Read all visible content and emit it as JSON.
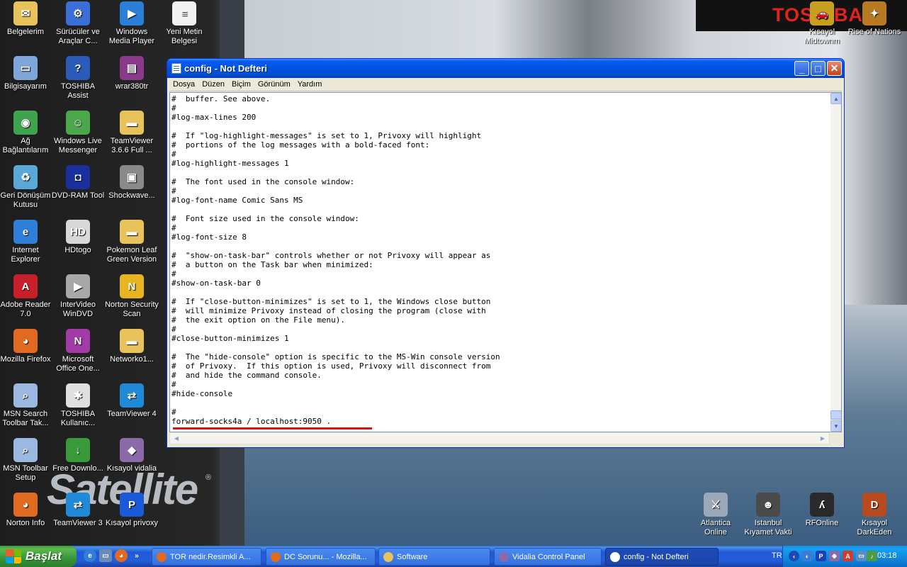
{
  "window": {
    "title": "config - Not Defteri",
    "menu": [
      "Dosya",
      "Düzen",
      "Biçim",
      "Görünüm",
      "Yardım"
    ]
  },
  "editor_lines": [
    "#  buffer. See above.",
    "#",
    "#log-max-lines 200",
    "",
    "#  If \"log-highlight-messages\" is set to 1, Privoxy will highlight",
    "#  portions of the log messages with a bold-faced font:",
    "#",
    "#log-highlight-messages 1",
    "",
    "#  The font used in the console window:",
    "#",
    "#log-font-name Comic Sans MS",
    "",
    "#  Font size used in the console window:",
    "#",
    "#log-font-size 8",
    "",
    "#  \"show-on-task-bar\" controls whether or not Privoxy will appear as",
    "#  a button on the Task bar when minimized:",
    "#",
    "#show-on-task-bar 0",
    "",
    "#  If \"close-button-minimizes\" is set to 1, the Windows close button",
    "#  will minimize Privoxy instead of closing the program (close with",
    "#  the exit option on the File menu).",
    "#",
    "#close-button-minimizes 1",
    "",
    "#  The \"hide-console\" option is specific to the MS-Win console version",
    "#  of Privoxy.  If this option is used, Privoxy will disconnect from",
    "#  and hide the command console.",
    "#",
    "#hide-console",
    "",
    "#",
    "forward-socks4a / localhost:9050 ."
  ],
  "annotation": {
    "color": "#e01010"
  },
  "wallpaper": {
    "brand": "TOSHIBA",
    "model": "Satellite",
    "reg": "®"
  },
  "desktop_icons": [
    {
      "label": "Belgelerim",
      "color": "#e8c25a",
      "glyph": "✉"
    },
    {
      "label": "Sürücüler ve Araçlar C...",
      "color": "#3a6fd8",
      "glyph": "⚙"
    },
    {
      "label": "Windows Media Player",
      "color": "#2b7fd8",
      "glyph": "▶"
    },
    {
      "label": "Yeni Metin Belgesi",
      "color": "#f2f2f2",
      "glyph": "≡"
    },
    {
      "label": "Bilgisayarım",
      "color": "#7fa6d8",
      "glyph": "▭"
    },
    {
      "label": "TOSHIBA Assist",
      "color": "#2a5bb8",
      "glyph": "?"
    },
    {
      "label": "wrar380tr",
      "color": "#8a3a8a",
      "glyph": "▤"
    },
    {
      "label": "Ağ Bağlantılarım",
      "color": "#3fa34d",
      "glyph": "◉"
    },
    {
      "label": "Windows Live Messenger",
      "color": "#4ca64c",
      "glyph": "☺"
    },
    {
      "label": "TeamViewer 3.6.6 Full ...",
      "color": "#e8c25a",
      "glyph": "▬"
    },
    {
      "label": "Geri Dönüşüm Kutusu",
      "color": "#5aa8d8",
      "glyph": "♻"
    },
    {
      "label": "DVD-RAM Tool",
      "color": "#1a2f9e",
      "glyph": "◘"
    },
    {
      "label": "Shockwave...",
      "color": "#8a8a8a",
      "glyph": "▣"
    },
    {
      "label": "Internet Explorer",
      "color": "#2f7fd8",
      "glyph": "e"
    },
    {
      "label": "HDtogo",
      "color": "#d8d8d8",
      "glyph": "HD"
    },
    {
      "label": "Pokemon Leaf Green Version",
      "color": "#e8c25a",
      "glyph": "▬"
    },
    {
      "label": "Adobe Reader 7.0",
      "color": "#c8202a",
      "glyph": "A"
    },
    {
      "label": "InterVideo WinDVD",
      "color": "#a8a8a8",
      "glyph": "▶"
    },
    {
      "label": "Norton Security Scan",
      "color": "#e8b520",
      "glyph": "N"
    },
    {
      "label": "Mozilla Firefox",
      "color": "#e06a1f",
      "glyph": "◕"
    },
    {
      "label": "Microsoft Office One...",
      "color": "#a23aa8",
      "glyph": "N"
    },
    {
      "label": "Networko1...",
      "color": "#e8c25a",
      "glyph": "▬"
    },
    {
      "label": "MSN Search Toolbar Tak...",
      "color": "#9ab8e0",
      "glyph": "⌕"
    },
    {
      "label": "TOSHIBA Kullanıc...",
      "color": "#e0e0e0",
      "glyph": "✱"
    },
    {
      "label": "TeamViewer 4",
      "color": "#1f8ad8",
      "glyph": "⇄"
    },
    {
      "label": "MSN Toolbar Setup",
      "color": "#9ab8e0",
      "glyph": "⌕"
    },
    {
      "label": "Free Downlo...",
      "color": "#3a9a3a",
      "glyph": "↓"
    },
    {
      "label": "Kısayol vidalia",
      "color": "#8a6aa8",
      "glyph": "◆"
    },
    {
      "label": "Norton Info",
      "color": "#e06a1f",
      "glyph": "◕"
    },
    {
      "label": "TeamViewer 3",
      "color": "#1f8ad8",
      "glyph": "⇄"
    },
    {
      "label": "Kısayol privoxy",
      "color": "#1a5ad8",
      "glyph": "P"
    },
    {
      "label": "Kısayol Midtownm",
      "color": "#c8a020",
      "glyph": "🚗"
    },
    {
      "label": "Rise of Nations",
      "color": "#b87a20",
      "glyph": "✦"
    },
    {
      "label": "Atlantica Online",
      "color": "#9aa8b8",
      "glyph": "⚔"
    },
    {
      "label": "Istanbul Kıyamet Vakti",
      "color": "#4a4a4a",
      "glyph": "☻"
    },
    {
      "label": "RFOnline",
      "color": "#2a2a2a",
      "glyph": "ʎ"
    },
    {
      "label": "Kısayol DarkEden",
      "color": "#b84a20",
      "glyph": "D"
    }
  ],
  "taskbar": {
    "start_label": "Başlat",
    "overflow_glyph": "»",
    "tasks": [
      {
        "label": "TOR nedir.Resimkli A...",
        "color": "#e06a1f"
      },
      {
        "label": "DC Sorunu... - Mozilla...",
        "color": "#e06a1f"
      },
      {
        "label": "Software",
        "color": "#e8c25a"
      },
      {
        "label": "Vidalia Control Panel",
        "color": "#8a6aa8"
      },
      {
        "label": "config - Not Defteri",
        "color": "#ffffff"
      }
    ],
    "lang": "TR",
    "clock": "03:18"
  }
}
